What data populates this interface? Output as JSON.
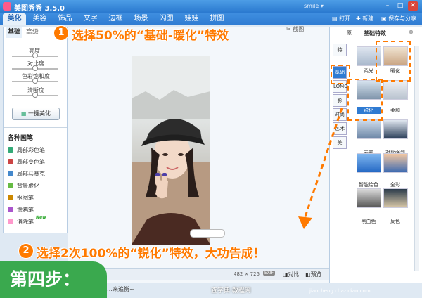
{
  "app": {
    "title": "美图秀秀 3.5.0",
    "user": "smile ▾"
  },
  "menu": {
    "tabs": [
      "美化",
      "美容",
      "饰品",
      "文字",
      "边框",
      "场景",
      "闪图",
      "娃娃",
      "拼图"
    ],
    "active": 0
  },
  "toolbar": {
    "open": "打开",
    "new": "新建",
    "save": "保存与分享"
  },
  "left": {
    "tabs": [
      "基础",
      "高级"
    ],
    "sliders": [
      "亮度",
      "对比度",
      "色彩饱和度",
      "清晰度"
    ],
    "beauty_button": "一键美化",
    "brush_header": "各种画笔",
    "brushes": [
      {
        "label": "局部彩色笔",
        "color": "#3a7"
      },
      {
        "label": "局部变色笔",
        "color": "#c44"
      },
      {
        "label": "局部马赛克",
        "color": "#48c"
      },
      {
        "label": "背景虚化",
        "color": "#6b4"
      },
      {
        "label": "抠图笔",
        "color": "#c80"
      },
      {
        "label": "涂鸦笔",
        "color": "#a5c"
      },
      {
        "label": "消除笔",
        "color": "#f9c"
      }
    ],
    "new_badge": "New"
  },
  "right": {
    "header": "基础特效",
    "tab_left": "原",
    "categories": [
      "特",
      "基础",
      "LOMO",
      "影",
      "时尚",
      "艺术",
      "美"
    ],
    "filters": [
      "柔光",
      "暖化",
      "锐化",
      "柔和",
      "去雾",
      "对比强烈",
      "智能绘色",
      "全彩",
      "黑白色",
      "反色"
    ]
  },
  "canvas": {
    "compare_btn": "对比",
    "preview_btn": "预览",
    "size": "482 × 725",
    "exif": "EXIF"
  },
  "annotations": {
    "step1_num": "1",
    "step1_text": "选择50%的“基础-暖化”特效",
    "step2_num": "2",
    "step2_text": "选择2次100%的“锐化”特效，大功告成！",
    "step_badge": "第四步：",
    "status_text": "…来追衡~",
    "watermark": "查字典 教程网",
    "watermark_url": "jiaocheng.chazidian.com"
  },
  "colors": {
    "accent": "#ff7a00",
    "titlebar": "#2a79cf",
    "step_badge": "#3aa94e"
  }
}
